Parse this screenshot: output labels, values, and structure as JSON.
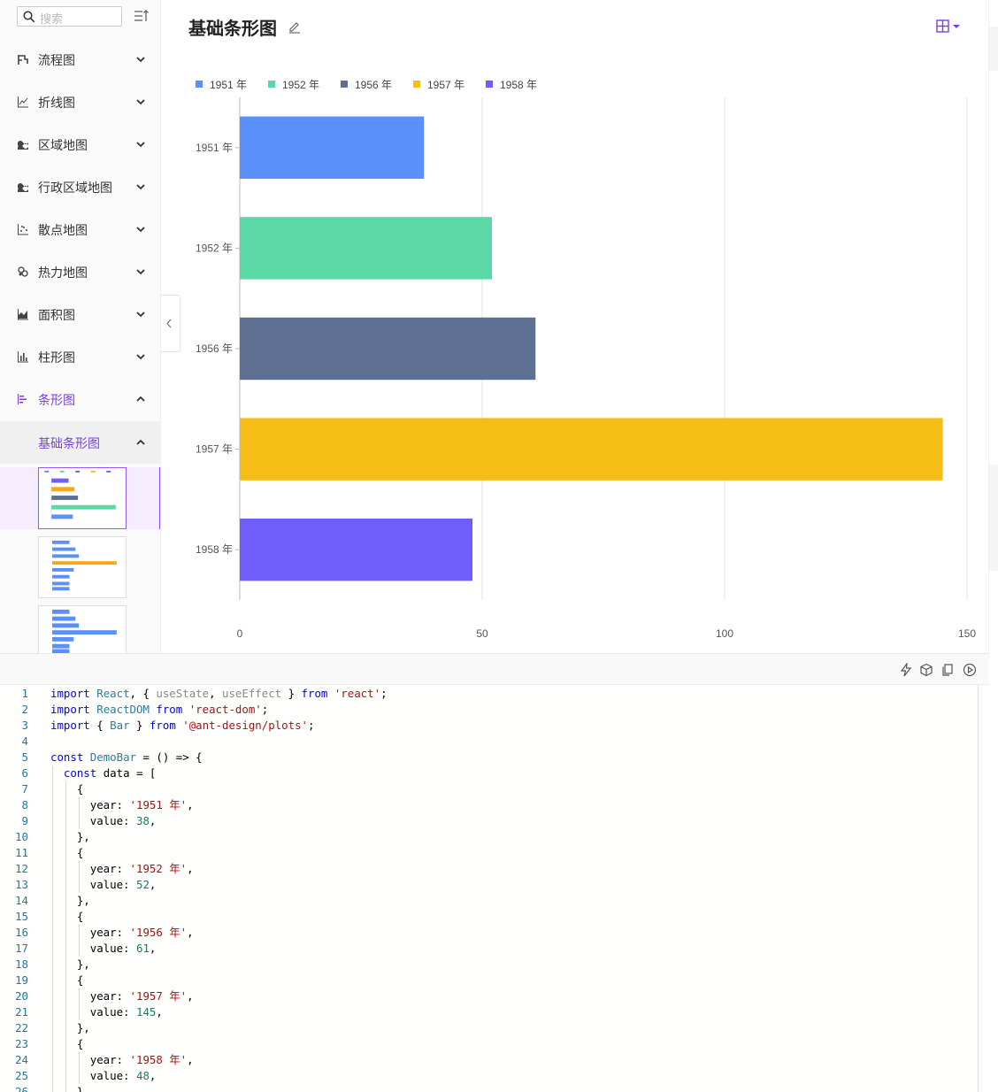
{
  "search": {
    "placeholder": "搜索"
  },
  "sidebar": {
    "items": [
      {
        "label": "流程图",
        "icon": "flow-icon",
        "expanded": false
      },
      {
        "label": "折线图",
        "icon": "line-chart-icon",
        "expanded": false
      },
      {
        "label": "区域地图",
        "icon": "area-map-icon",
        "expanded": false
      },
      {
        "label": "行政区域地图",
        "icon": "district-map-icon",
        "expanded": false
      },
      {
        "label": "散点地图",
        "icon": "scatter-map-icon",
        "expanded": false
      },
      {
        "label": "热力地图",
        "icon": "heat-map-icon",
        "expanded": false
      },
      {
        "label": "面积图",
        "icon": "area-chart-icon",
        "expanded": false
      },
      {
        "label": "柱形图",
        "icon": "column-chart-icon",
        "expanded": false
      },
      {
        "label": "条形图",
        "icon": "bar-chart-icon",
        "expanded": true
      }
    ],
    "sub_item": {
      "label": "基础条形图",
      "expanded": true
    }
  },
  "page": {
    "title": "基础条形图"
  },
  "colors": {
    "accent": "#7b3fe4"
  },
  "chart_data": {
    "type": "bar",
    "orientation": "horizontal",
    "categories": [
      "1951 年",
      "1952 年",
      "1956 年",
      "1957 年",
      "1958 年"
    ],
    "values": [
      38,
      52,
      61,
      145,
      48
    ],
    "colors": [
      "#5b8ff9",
      "#5ad8a6",
      "#5d7092",
      "#f6bd16",
      "#6f5ef9"
    ],
    "legend": [
      "1951 年",
      "1952 年",
      "1956 年",
      "1957 年",
      "1958 年"
    ],
    "legend_position": "top-left",
    "xlim": [
      0,
      150
    ],
    "xticks": [
      0,
      50,
      100,
      150
    ],
    "grid": true
  },
  "code": {
    "lines": [
      "import React, { useState, useEffect } from 'react';",
      "import ReactDOM from 'react-dom';",
      "import { Bar } from '@ant-design/plots';",
      "",
      "const DemoBar = () => {",
      "  const data = [",
      "    {",
      "      year: '1951 年',",
      "      value: 38,",
      "    },",
      "    {",
      "      year: '1952 年',",
      "      value: 52,",
      "    },",
      "    {",
      "      year: '1956 年',",
      "      value: 61,",
      "    },",
      "    {",
      "      year: '1957 年',",
      "      value: 145,",
      "    },",
      "    {",
      "      year: '1958 年',",
      "      value: 48,",
      "    },"
    ]
  }
}
